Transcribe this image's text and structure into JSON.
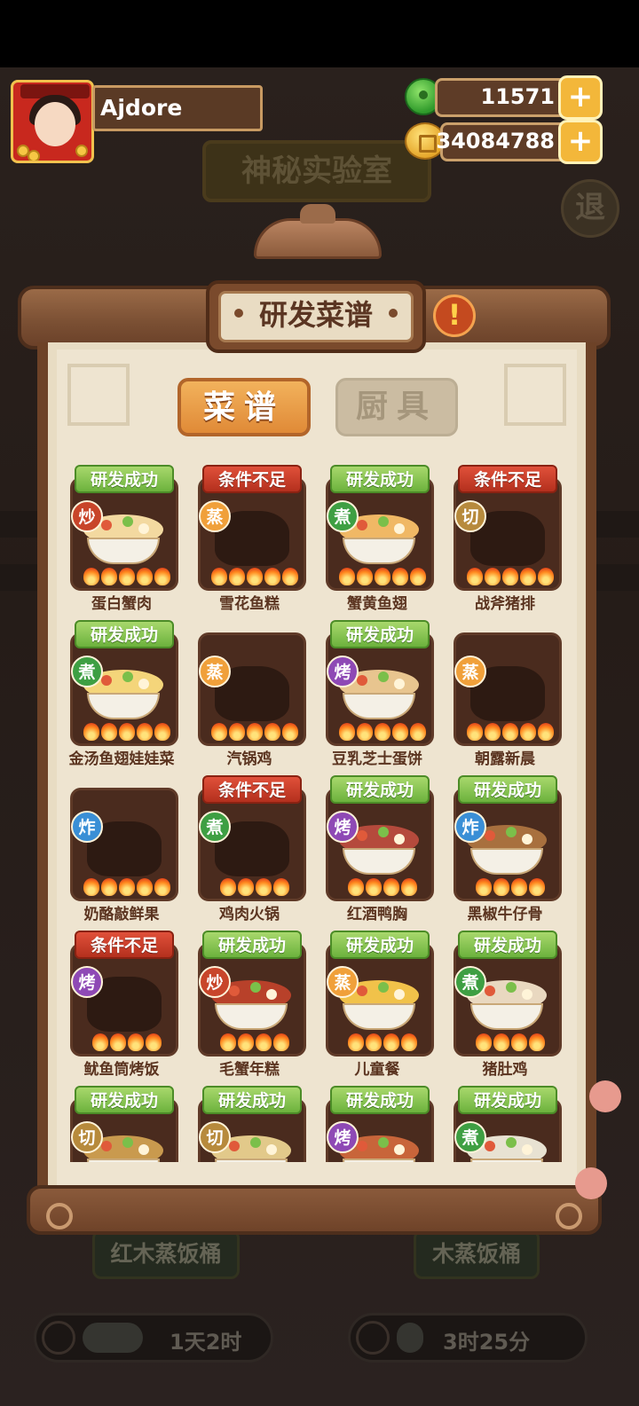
{
  "player": {
    "name": "Ajdore",
    "jade": "11571",
    "coins": "34084788"
  },
  "background": {
    "lab_title": "神秘实验室",
    "exit_label": "退",
    "plates": [
      "红木蒸饭桶",
      "木蒸饭桶"
    ],
    "timers": [
      "1天2时",
      "3时25分"
    ]
  },
  "panel": {
    "title": "研发菜谱",
    "info_icon": "!",
    "tabs": [
      "菜谱",
      "厨具"
    ]
  },
  "method_labels": {
    "chao": "炒",
    "zheng": "蒸",
    "zhu": "煮",
    "qie": "切",
    "kao": "烤",
    "zha": "炸"
  },
  "status_labels": {
    "ok": "研发成功",
    "fail": "条件不足"
  },
  "recipes": [
    {
      "name": "蛋白蟹肉",
      "status": "研发成功",
      "method": "炒",
      "flames": 5,
      "unlocked": true,
      "color": "#f3d9a0"
    },
    {
      "name": "雪花鱼糕",
      "status": "条件不足",
      "method": "蒸",
      "flames": 5,
      "unlocked": false
    },
    {
      "name": "蟹黄鱼翅",
      "status": "研发成功",
      "method": "煮",
      "flames": 5,
      "unlocked": true,
      "color": "#f0b865"
    },
    {
      "name": "战斧猪排",
      "status": "条件不足",
      "method": "切",
      "flames": 5,
      "unlocked": false
    },
    {
      "name": "金汤鱼翅娃娃菜",
      "status": "研发成功",
      "method": "煮",
      "flames": 5,
      "unlocked": true,
      "color": "#f4d57a"
    },
    {
      "name": "汽锅鸡",
      "status": "",
      "method": "蒸",
      "flames": 5,
      "unlocked": false
    },
    {
      "name": "豆乳芝士蛋饼",
      "status": "研发成功",
      "method": "烤",
      "flames": 5,
      "unlocked": true,
      "color": "#e8c58f"
    },
    {
      "name": "朝露新晨",
      "status": "",
      "method": "蒸",
      "flames": 5,
      "unlocked": false
    },
    {
      "name": "奶酪敲鲜果",
      "status": "",
      "method": "炸",
      "flames": 5,
      "unlocked": false
    },
    {
      "name": "鸡肉火锅",
      "status": "条件不足",
      "method": "煮",
      "flames": 4,
      "unlocked": false
    },
    {
      "name": "红酒鸭胸",
      "status": "研发成功",
      "method": "烤",
      "flames": 4,
      "unlocked": true,
      "color": "#b54a3c"
    },
    {
      "name": "黑椒牛仔骨",
      "status": "研发成功",
      "method": "炸",
      "flames": 4,
      "unlocked": true,
      "color": "#a8703e"
    },
    {
      "name": "鱿鱼筒烤饭",
      "status": "条件不足",
      "method": "烤",
      "flames": 4,
      "unlocked": false
    },
    {
      "name": "毛蟹年糕",
      "status": "研发成功",
      "method": "炒",
      "flames": 4,
      "unlocked": true,
      "color": "#b8412a"
    },
    {
      "name": "儿童餐",
      "status": "研发成功",
      "method": "蒸",
      "flames": 4,
      "unlocked": true,
      "color": "#f1c24a"
    },
    {
      "name": "猪肚鸡",
      "status": "研发成功",
      "method": "煮",
      "flames": 4,
      "unlocked": true,
      "color": "#e9d8c0"
    },
    {
      "name": "",
      "status": "研发成功",
      "method": "切",
      "flames": 0,
      "unlocked": true,
      "color": "#c99a4e"
    },
    {
      "name": "",
      "status": "研发成功",
      "method": "切",
      "flames": 0,
      "unlocked": true,
      "color": "#e2c98a"
    },
    {
      "name": "",
      "status": "研发成功",
      "method": "烤",
      "flames": 0,
      "unlocked": true,
      "color": "#c8653a"
    },
    {
      "name": "",
      "status": "研发成功",
      "method": "煮",
      "flames": 0,
      "unlocked": true,
      "color": "#e8e2d2"
    }
  ]
}
